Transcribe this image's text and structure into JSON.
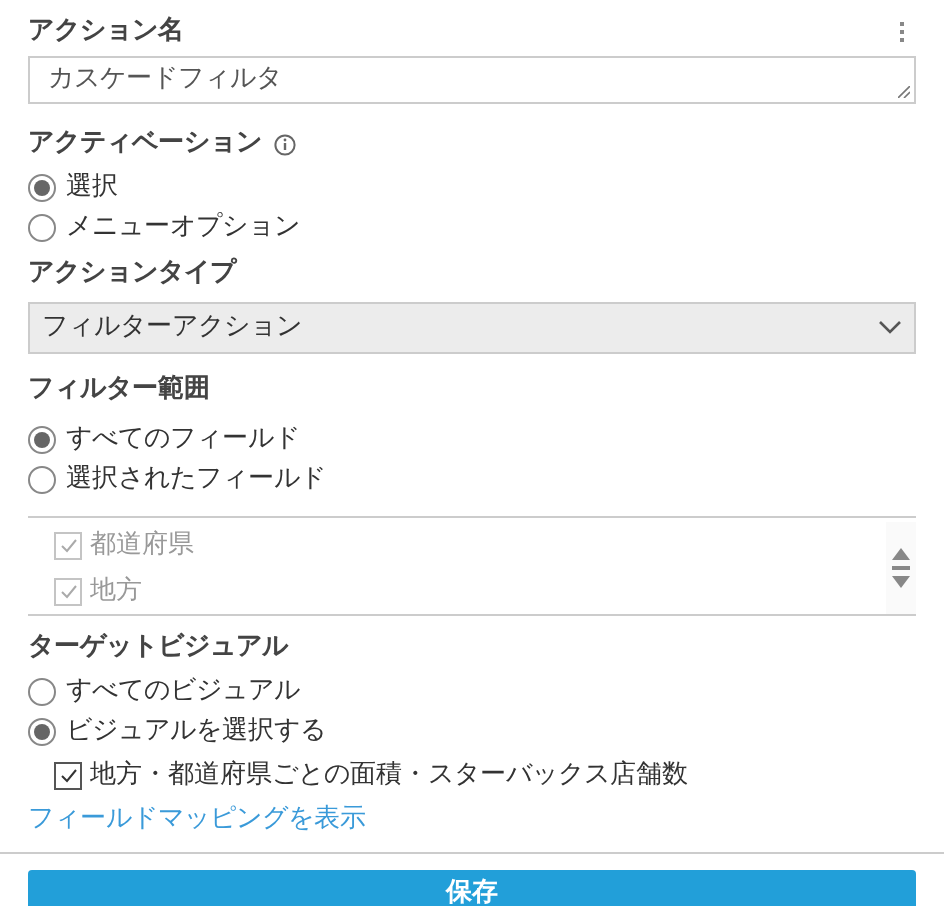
{
  "action_name": {
    "label": "アクション名",
    "value": "カスケードフィルタ"
  },
  "activation": {
    "label": "アクティベーション",
    "options": [
      {
        "label": "選択",
        "selected": true
      },
      {
        "label": "メニューオプション",
        "selected": false
      }
    ]
  },
  "action_type": {
    "label": "アクションタイプ",
    "value": "フィルターアクション"
  },
  "filter_scope": {
    "label": "フィルター範囲",
    "options": [
      {
        "label": "すべてのフィールド",
        "selected": true
      },
      {
        "label": "選択されたフィールド",
        "selected": false
      }
    ],
    "fields_disabled": true,
    "fields": [
      {
        "label": "都道府県",
        "checked": true
      },
      {
        "label": "地方",
        "checked": true
      }
    ]
  },
  "target_visual": {
    "label": "ターゲットビジュアル",
    "options": [
      {
        "label": "すべてのビジュアル",
        "selected": false
      },
      {
        "label": "ビジュアルを選択する",
        "selected": true
      }
    ],
    "visuals": [
      {
        "label": "地方・都道府県ごとの面積・スターバックス店舗数",
        "checked": true
      }
    ]
  },
  "link": "フィールドマッピングを表示",
  "save_button": "保存"
}
